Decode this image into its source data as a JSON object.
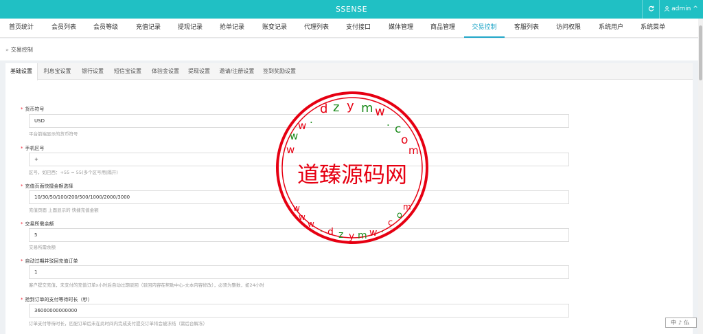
{
  "header": {
    "brand": "SSENSE",
    "refresh_icon": "refresh-icon",
    "user_icon": "user-icon",
    "user_name": "admin",
    "user_caret": "^"
  },
  "nav": {
    "items": [
      {
        "label": "首页统计"
      },
      {
        "label": "会员列表"
      },
      {
        "label": "会员等级"
      },
      {
        "label": "充值记录"
      },
      {
        "label": "提现记录"
      },
      {
        "label": "抢单记录"
      },
      {
        "label": "账变记录"
      },
      {
        "label": "代理列表"
      },
      {
        "label": "支付接口"
      },
      {
        "label": "媒体管理"
      },
      {
        "label": "商品管理"
      },
      {
        "label": "交易控制",
        "active": true
      },
      {
        "label": "客服列表"
      },
      {
        "label": "访问权限"
      },
      {
        "label": "系统用户"
      },
      {
        "label": "系统菜单"
      }
    ]
  },
  "breadcrumb": {
    "separator": "»",
    "current": "交易控制"
  },
  "tabs": [
    {
      "label": "基础设置",
      "active": true
    },
    {
      "label": "利息宝设置"
    },
    {
      "label": "银行设置"
    },
    {
      "label": "短信宝设置"
    },
    {
      "label": "体验金设置"
    },
    {
      "label": "提现设置"
    },
    {
      "label": "邀请/注册设置"
    },
    {
      "label": "签到奖励设置"
    }
  ],
  "form": {
    "required_mark": "*",
    "fields": [
      {
        "label": "货币符号",
        "value": "USD",
        "help": "平台前端显示的货币符号"
      },
      {
        "label": "手机区号",
        "value": "+",
        "help": "区号，如巴西：+55 = 55(多个区号用|隔开)"
      },
      {
        "label": "充值页面快捷金额选择",
        "value": "10/30/50/100/200/500/1000/2000/3000",
        "help": "充值页面 上面显示的 快捷充值金额"
      },
      {
        "label": "交易所需余额",
        "value": "5",
        "help": "交易所需余额"
      },
      {
        "label": "自动过期并驳回充值订单",
        "value": "1",
        "help": "客户提交充值，未支付的充值订单x小时后自动过期驳回（驳回内容在帮助中心-文本内容修改），必须为整数，如24小时"
      },
      {
        "label": "抢到订单的支付等待时长（秒）",
        "value": "36000000000000",
        "help": "订单支付等待时长，匹配订单后未在此时间内完成支付提交订单将会被冻结（需后台解冻）"
      }
    ]
  },
  "watermark": {
    "main_text": "道臻源码网",
    "ring_top": "www.dzymw.com",
    "ring_bottom": "www.dzymw.com"
  },
  "corner_badge": {
    "text": "中♪仏"
  },
  "colors": {
    "topbar": "#20c0c4",
    "active_nav": "#20a6c8",
    "seal_red": "#e60012",
    "seal_green": "#1a8a1a"
  }
}
